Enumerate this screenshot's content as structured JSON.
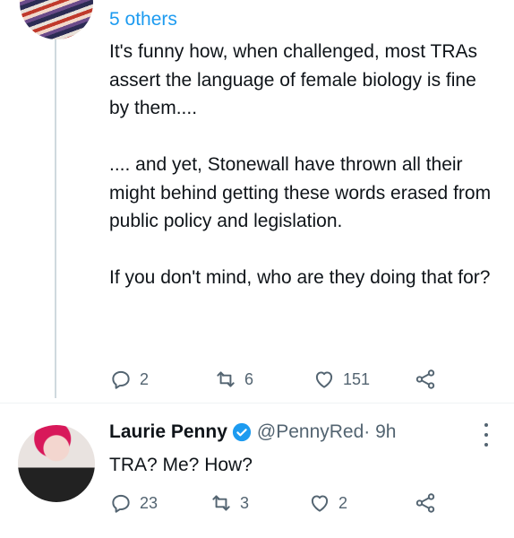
{
  "thread": {
    "others_label": "5 others",
    "tweet_text": "It's funny how, when challenged, most TRAs assert the language of female biology is fine by them....\n\n.... and yet, Stonewall have thrown all their might behind getting these words erased from public policy and legislation.\n\nIf you don't mind, who are they doing that for?",
    "replies": "2",
    "retweets": "6",
    "likes": "151"
  },
  "reply": {
    "author_name": "Laurie Penny",
    "handle": "@PennyRed",
    "time": " · 9h",
    "text": "TRA? Me? How?",
    "replies": "23",
    "retweets": "3",
    "likes": "2"
  },
  "colors": {
    "accent": "#1d9bf0",
    "muted": "#536471",
    "text": "#0f1419"
  },
  "icons": [
    "reply-icon",
    "retweet-icon",
    "like-icon",
    "share-icon",
    "verified-icon",
    "more-icon"
  ]
}
